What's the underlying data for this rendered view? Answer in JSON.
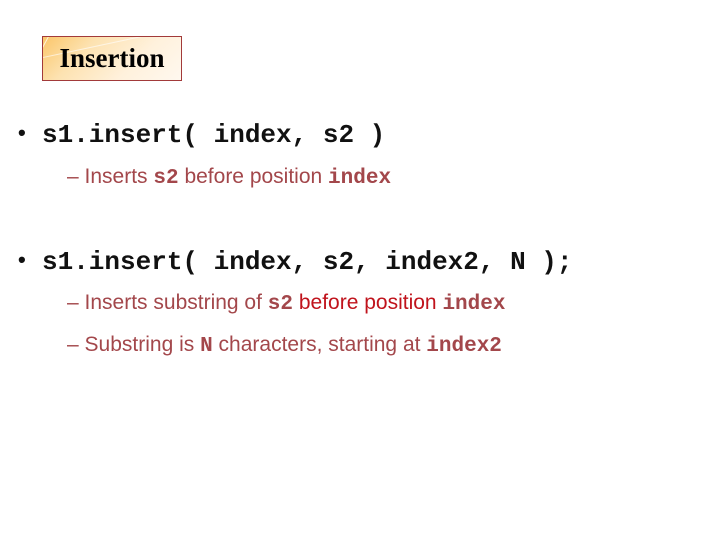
{
  "slide": {
    "title": "Insertion",
    "colors": {
      "title_border": "#a23a3a",
      "title_gradient_start": "#fbc66a",
      "title_gradient_end": "#fff8ef",
      "bullet_text": "#111111",
      "sub_text": "#a3474b",
      "emphasis_red": "#c0131c"
    },
    "bullets": [
      {
        "marker": "•",
        "code": "s1.insert( index, s2 )",
        "subs": [
          {
            "dash": "–",
            "parts": [
              "Inserts ",
              "s2",
              " before position ",
              "index"
            ]
          }
        ]
      },
      {
        "marker": "•",
        "code": "s1.insert( index, s2, index2, N );",
        "subs": [
          {
            "dash": "–",
            "parts": [
              "Inserts substring of ",
              "s2",
              " before position ",
              "index"
            ]
          },
          {
            "dash": "–",
            "parts": [
              "Substring is ",
              "N",
              " characters, starting at ",
              "index2"
            ]
          }
        ]
      }
    ]
  }
}
